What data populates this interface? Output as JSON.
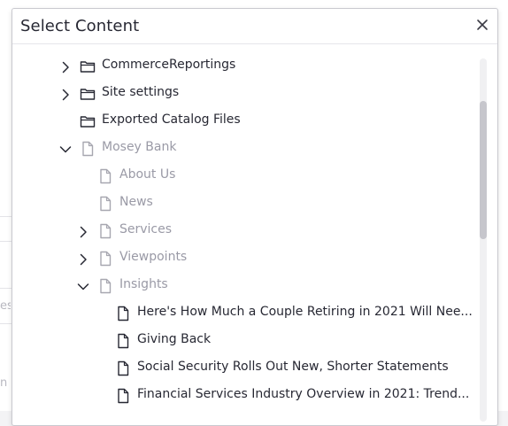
{
  "dialog": {
    "title": "Select Content",
    "close_icon": "close-icon"
  },
  "background": {
    "fragments": [
      "es",
      "n c"
    ]
  },
  "tree": [
    {
      "name": "tree-item-commercereportings",
      "label": "CommerceReportings",
      "icon": "folder-icon",
      "expand": "collapsed",
      "level": 0,
      "muted": false
    },
    {
      "name": "tree-item-site-settings",
      "label": "Site settings",
      "icon": "folder-icon",
      "expand": "collapsed",
      "level": 0,
      "muted": false
    },
    {
      "name": "tree-item-exported-catalog-files",
      "label": "Exported Catalog Files",
      "icon": "folder-icon",
      "expand": "none",
      "level": 0,
      "muted": false
    },
    {
      "name": "tree-item-mosey-bank",
      "label": "Mosey Bank",
      "icon": "page-icon",
      "expand": "expanded",
      "level": 0,
      "muted": true
    },
    {
      "name": "tree-item-about-us",
      "label": "About Us",
      "icon": "page-icon",
      "expand": "none",
      "level": 1,
      "muted": true
    },
    {
      "name": "tree-item-news",
      "label": "News",
      "icon": "page-icon",
      "expand": "none",
      "level": 1,
      "muted": true
    },
    {
      "name": "tree-item-services",
      "label": "Services",
      "icon": "page-icon",
      "expand": "collapsed",
      "level": 1,
      "muted": true
    },
    {
      "name": "tree-item-viewpoints",
      "label": "Viewpoints",
      "icon": "page-icon",
      "expand": "collapsed",
      "level": 1,
      "muted": true
    },
    {
      "name": "tree-item-insights",
      "label": "Insights",
      "icon": "page-icon",
      "expand": "expanded",
      "level": 1,
      "muted": true
    },
    {
      "name": "tree-item-couple-retiring",
      "label": "Here's How Much a Couple Retiring in 2021 Will Nee...",
      "icon": "page-icon",
      "expand": "none",
      "level": 2,
      "muted": false
    },
    {
      "name": "tree-item-giving-back",
      "label": "Giving Back",
      "icon": "page-icon",
      "expand": "none",
      "level": 2,
      "muted": false
    },
    {
      "name": "tree-item-social-security",
      "label": "Social Security Rolls Out New, Shorter Statements",
      "icon": "page-icon",
      "expand": "none",
      "level": 2,
      "muted": false
    },
    {
      "name": "tree-item-financial-services",
      "label": "Financial Services Industry Overview in 2021: Trend...",
      "icon": "page-icon",
      "expand": "none",
      "level": 2,
      "muted": false
    }
  ],
  "colors": {
    "text": "#272833",
    "muted": "#9a9aa6",
    "icon_dark": "#272833",
    "icon_muted": "#a7a7b0"
  }
}
